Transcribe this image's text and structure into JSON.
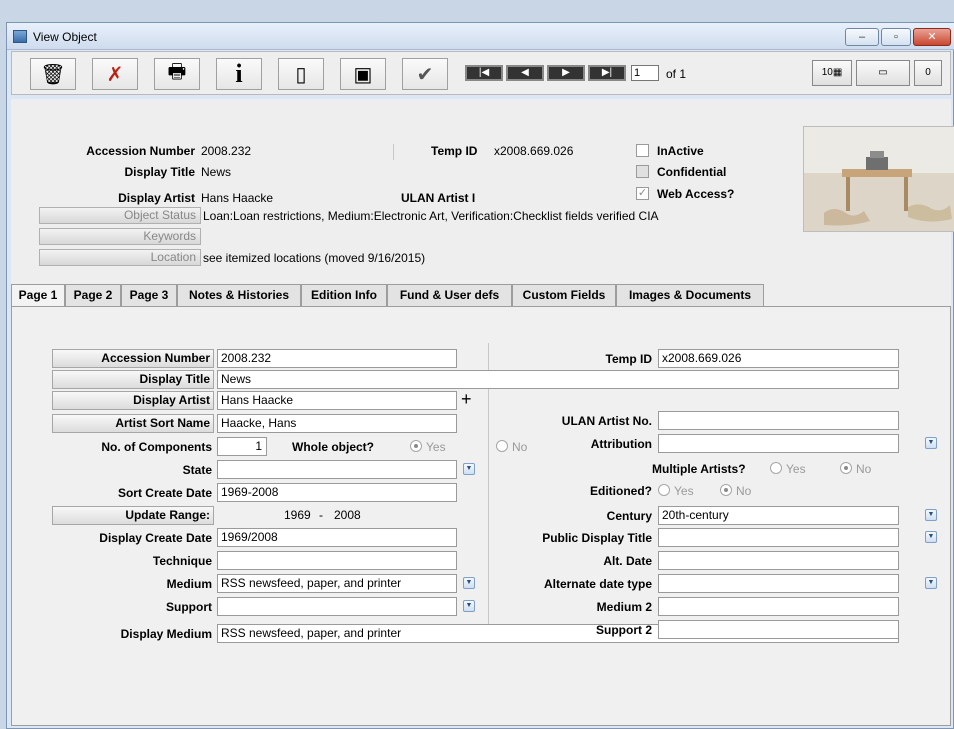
{
  "window": {
    "title": "View Object",
    "min": "–",
    "max": "▫",
    "close": "✕"
  },
  "toolbar": {
    "delete_icon": "🗑",
    "cancel_icon": "✗",
    "print_icon": "🖶",
    "info_icon": "i",
    "new_icon": "▯",
    "copy_icon": "▣",
    "check_icon": "✔",
    "nav_first": "|◀",
    "nav_prev": "◀",
    "nav_next": "▶",
    "nav_last": "▶|",
    "record": "1",
    "of": "of 1",
    "view_grid": "10▦",
    "view_form": "▭",
    "view_single": "0"
  },
  "header": {
    "accession_label": "Accession Number",
    "accession_value": "2008.232",
    "display_title_label": "Display Title",
    "display_title_value": "News",
    "display_artist_label": "Display Artist",
    "display_artist_value": "Hans Haacke",
    "temp_id_label": "Temp ID",
    "temp_id_value": "x2008.669.026",
    "ulan_label": "ULAN Artist I",
    "inactive_label": "InActive",
    "confidential_label": "Confidential",
    "web_access_label": "Web Access?",
    "object_status_btn": "Object Status",
    "object_status_value": "Loan:Loan restrictions, Medium:Electronic Art, Verification:Checklist fields verified CIA",
    "keywords_btn": "Keywords",
    "location_btn": "Location",
    "location_value": "see itemized locations (moved 9/16/2015)"
  },
  "tabs": [
    "Page 1",
    "Page 2",
    "Page 3",
    "Notes & Histories",
    "Edition Info",
    "Fund & User defs",
    "Custom Fields",
    "Images & Documents"
  ],
  "form": {
    "accession_label": "Accession Number",
    "accession_value": "2008.232",
    "display_title_label": "Display Title",
    "display_title_value": "News",
    "display_artist_label": "Display Artist",
    "display_artist_value": "Hans Haacke",
    "add_artist": "+",
    "artist_sort_label": "Artist Sort Name",
    "artist_sort_value": "Haacke, Hans",
    "components_label": "No. of Components",
    "components_value": "1",
    "whole_label": "Whole object?",
    "yes": "Yes",
    "no": "No",
    "state_label": "State",
    "state_value": "",
    "sort_create_label": "Sort Create Date",
    "sort_create_value": "1969-2008",
    "update_range_label": "Update Range:",
    "range_start": "1969",
    "range_sep": "-",
    "range_end": "2008",
    "display_create_label": "Display Create Date",
    "display_create_value": "1969/2008",
    "technique_label": "Technique",
    "technique_value": "",
    "medium_label": "Medium",
    "medium_value": "RSS newsfeed, paper, and printer",
    "support_label": "Support",
    "support_value": "",
    "display_medium_label": "Display Medium",
    "display_medium_value": "RSS newsfeed, paper, and printer",
    "temp_id_label": "Temp ID",
    "temp_id_value": "x2008.669.026",
    "ulan_label": "ULAN Artist No.",
    "ulan_value": "",
    "attribution_label": "Attribution",
    "attribution_value": "",
    "multiple_label": "Multiple Artists?",
    "editioned_label": "Editioned?",
    "century_label": "Century",
    "century_value": "20th-century",
    "public_title_label": "Public Display Title",
    "public_title_value": "",
    "alt_date_label": "Alt. Date",
    "alt_date_value": "",
    "alt_date_type_label": "Alternate date type",
    "alt_date_type_value": "",
    "medium2_label": "Medium 2",
    "medium2_value": "",
    "support2_label": "Support 2",
    "support2_value": ""
  },
  "icons": {
    "dropdown": "▼"
  }
}
